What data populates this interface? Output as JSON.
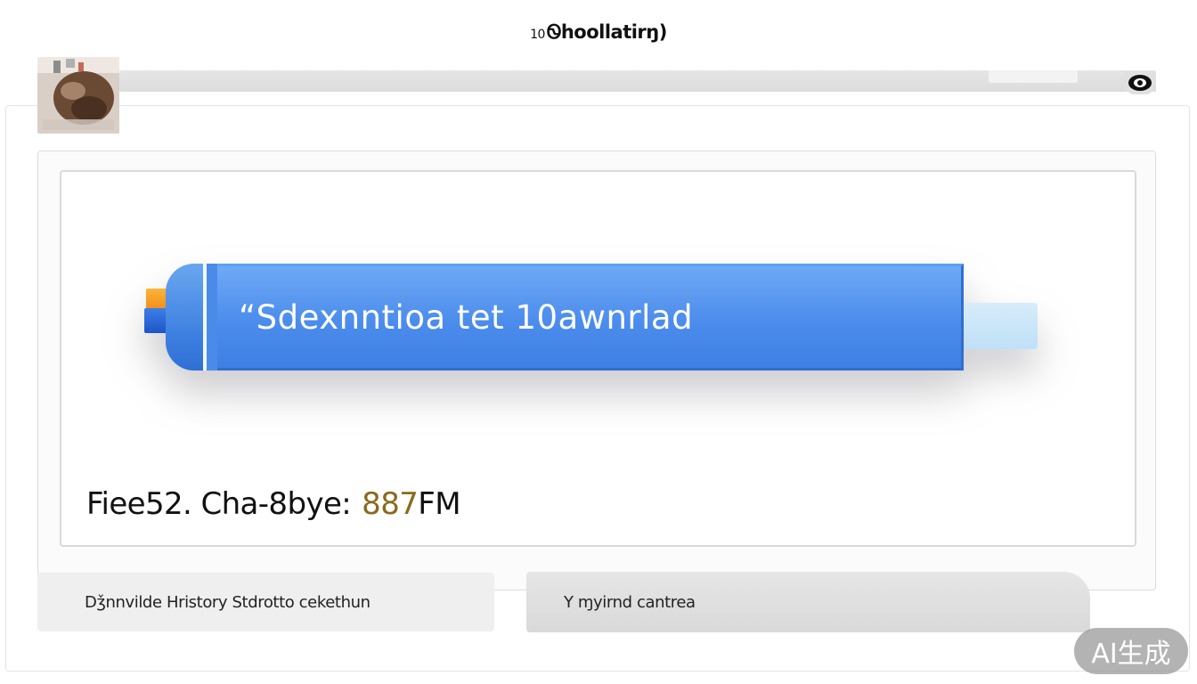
{
  "header": {
    "title_prefix": "10",
    "title": "Ꮻhoollatirŋ)"
  },
  "address_bar": {
    "eye_icon": "eye-icon"
  },
  "usb_drive": {
    "label": "“Sdexnntioa tet 10awnrlad",
    "body_color": "#4b8cec"
  },
  "file_info": {
    "label": "Fiee52. Cha-8bye:",
    "size_digits": "887",
    "size_unit": "FM"
  },
  "actions": {
    "history_label": "Dǯnnvilde Hristory Stdrotto cekethun",
    "center_label": "Y ɱyirnd cantrea"
  },
  "badge": {
    "label": "AI生成"
  }
}
